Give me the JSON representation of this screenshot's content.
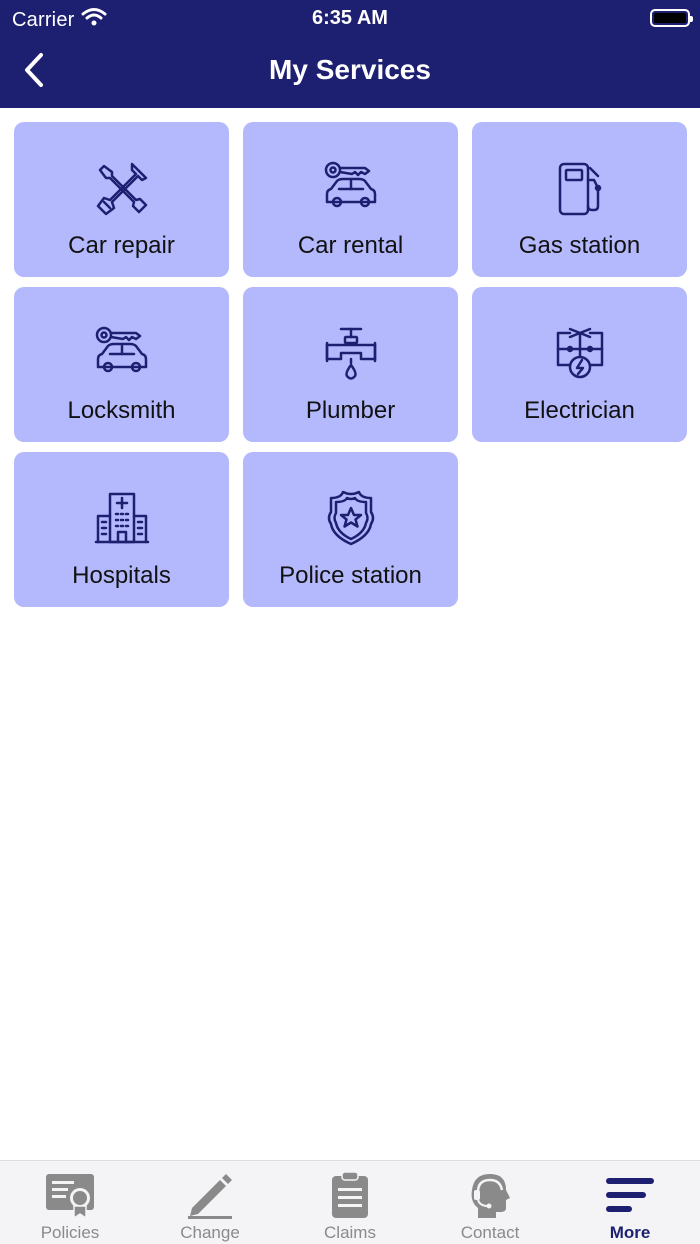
{
  "status_bar": {
    "carrier": "Carrier",
    "time": "6:35 AM"
  },
  "nav": {
    "title": "My Services",
    "back_icon": "chevron-left-icon"
  },
  "colors": {
    "header": "#1d1f70",
    "tile": "#b4b8fc",
    "icon": "#1d1f70",
    "tab_inactive": "#8a8a8a",
    "tab_active": "#1d1f70"
  },
  "services": [
    {
      "label": "Car repair",
      "icon": "tools-icon"
    },
    {
      "label": "Car rental",
      "icon": "car-key-icon"
    },
    {
      "label": "Gas station",
      "icon": "fuel-pump-icon"
    },
    {
      "label": "Locksmith",
      "icon": "car-key-icon"
    },
    {
      "label": "Plumber",
      "icon": "faucet-icon"
    },
    {
      "label": "Electrician",
      "icon": "electric-circuit-icon"
    },
    {
      "label": "Hospitals",
      "icon": "hospital-icon"
    },
    {
      "label": "Police station",
      "icon": "police-badge-icon"
    }
  ],
  "tabs": [
    {
      "label": "Policies",
      "icon": "certificate-icon",
      "active": false
    },
    {
      "label": "Change",
      "icon": "pencil-icon",
      "active": false
    },
    {
      "label": "Claims",
      "icon": "clipboard-icon",
      "active": false
    },
    {
      "label": "Contact",
      "icon": "headset-icon",
      "active": false
    },
    {
      "label": "More",
      "icon": "menu-lines-icon",
      "active": true
    }
  ]
}
